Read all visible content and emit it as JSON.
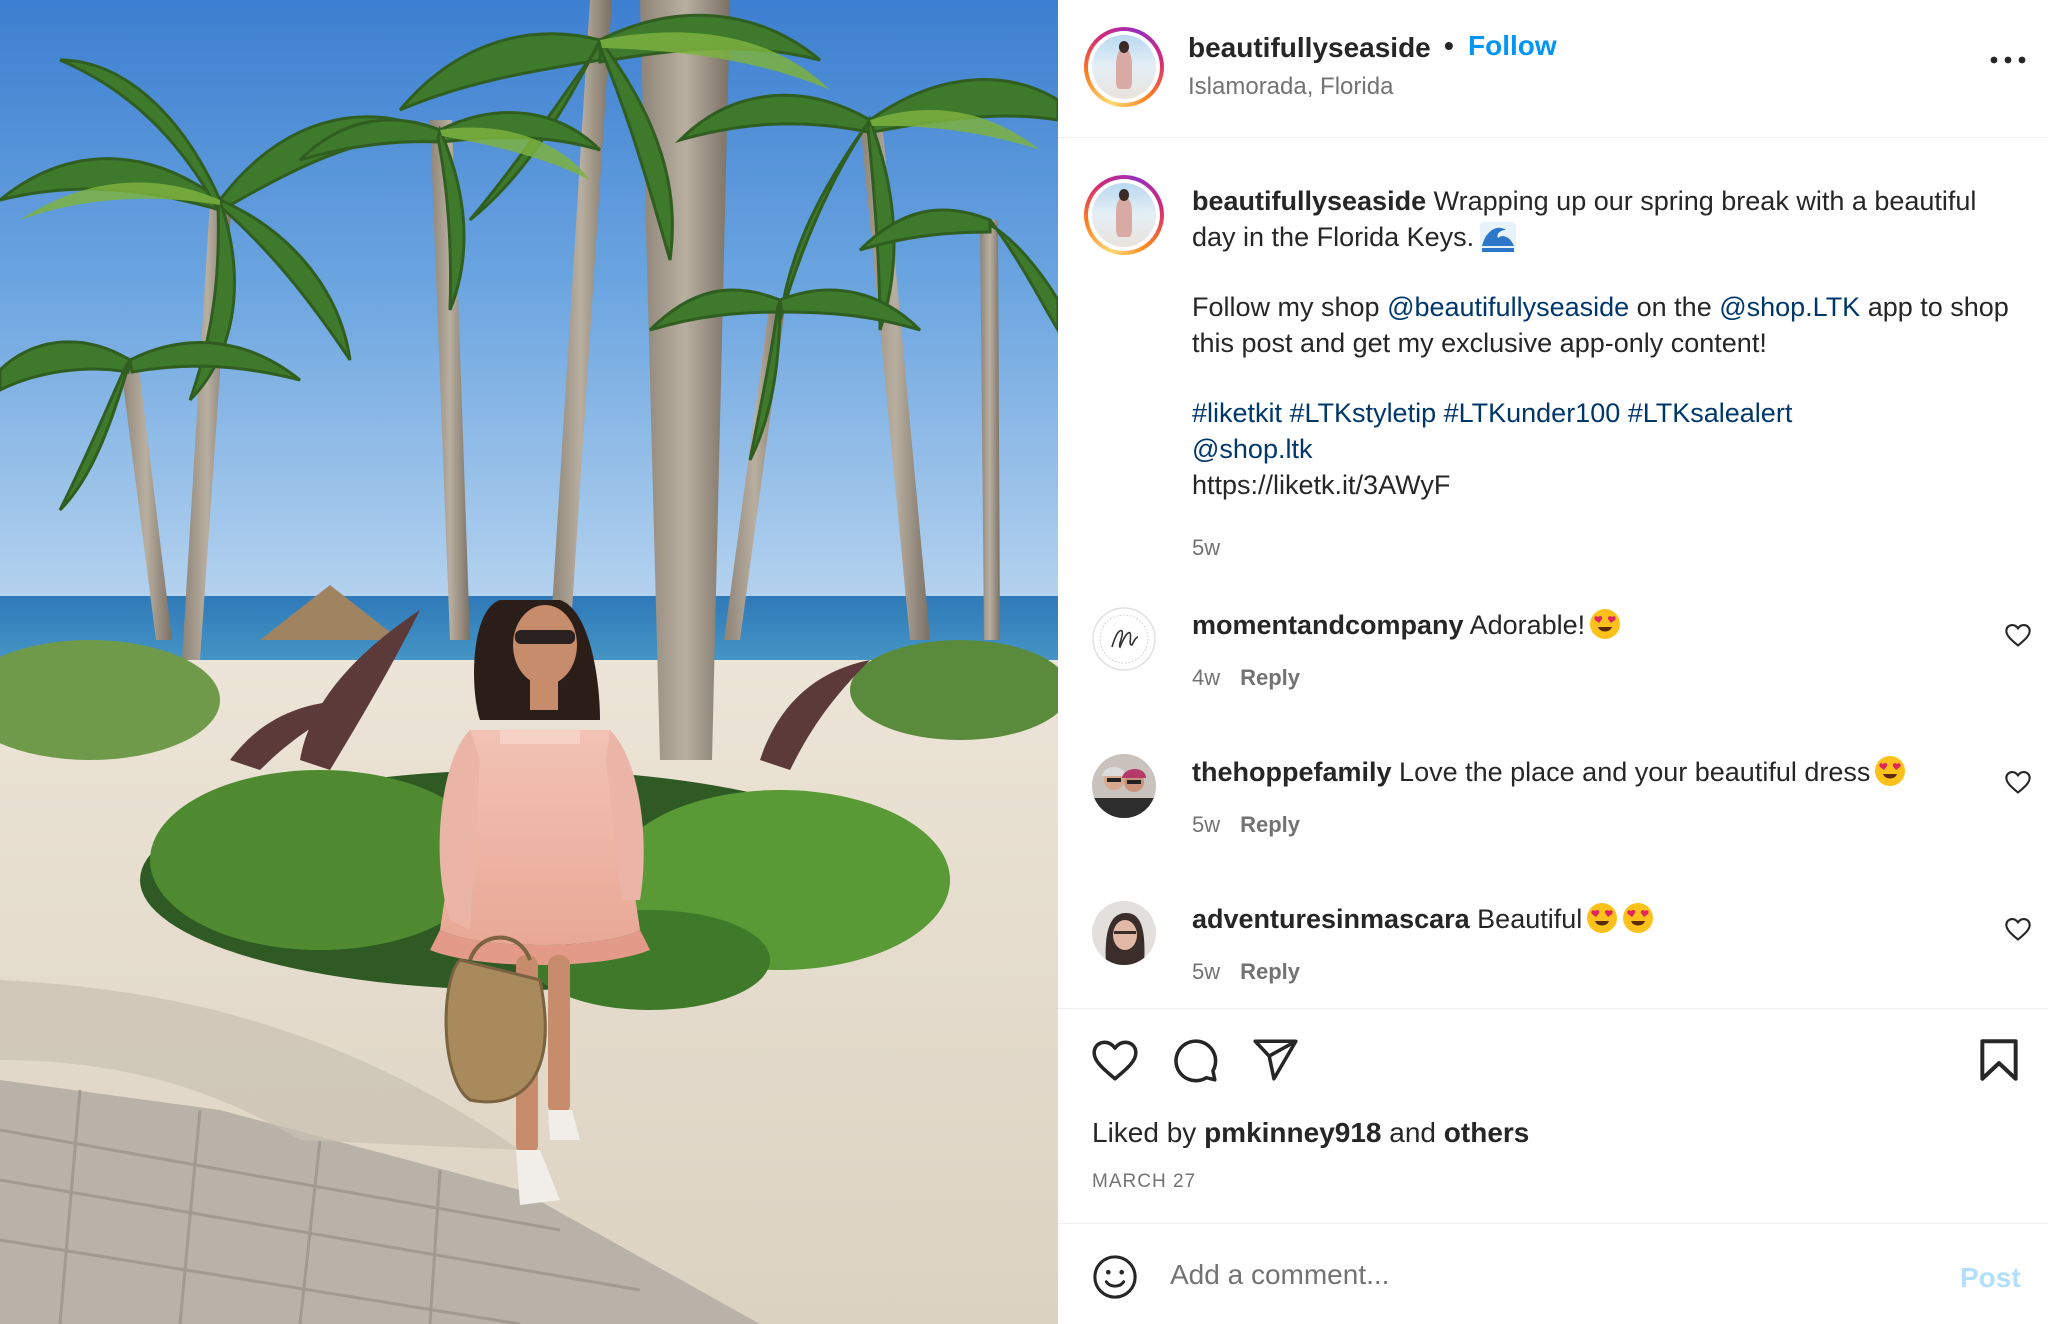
{
  "post": {
    "username": "beautifullyseaside",
    "separator": "•",
    "follow_label": "Follow",
    "location": "Islamorada, Florida",
    "more_icon": "more-horizontal-icon"
  },
  "caption": {
    "username": "beautifullyseaside",
    "line1": "Wrapping up our spring break with a beautiful day in the Florida Keys.",
    "line2_a": "Follow my shop ",
    "line2_mention1": "@beautifullyseaside",
    "line2_b": " on the ",
    "line2_mention2": "@shop.LTK",
    "line2_c": " app to shop this post and get my exclusive app-only content!",
    "hashtags": "#liketkit #LTKstyletip #LTKunder100 #LTKsalealert",
    "mention3": "@shop.ltk",
    "url": "https://liketk.it/3AWyF",
    "time": "5w"
  },
  "comments": [
    {
      "username": "momentandcompany",
      "text": "Adorable!",
      "time": "4w",
      "reply_label": "Reply"
    },
    {
      "username": "thehoppefamily",
      "text": "Love the place and your beautiful dress",
      "time": "5w",
      "reply_label": "Reply"
    },
    {
      "username": "adventuresinmascara",
      "text": "Beautiful",
      "time": "5w",
      "reply_label": "Reply"
    }
  ],
  "actions": {
    "liked_prefix": "Liked by ",
    "liked_user": "pmkinney918",
    "liked_mid": " and ",
    "liked_others": "others",
    "date": "MARCH 27"
  },
  "add_comment": {
    "placeholder": "Add a comment...",
    "post_label": "Post"
  },
  "colors": {
    "link_blue": "#0095f6",
    "mention_navy": "#00376b",
    "muted": "#737373",
    "post_disabled": "#b2dffc"
  }
}
